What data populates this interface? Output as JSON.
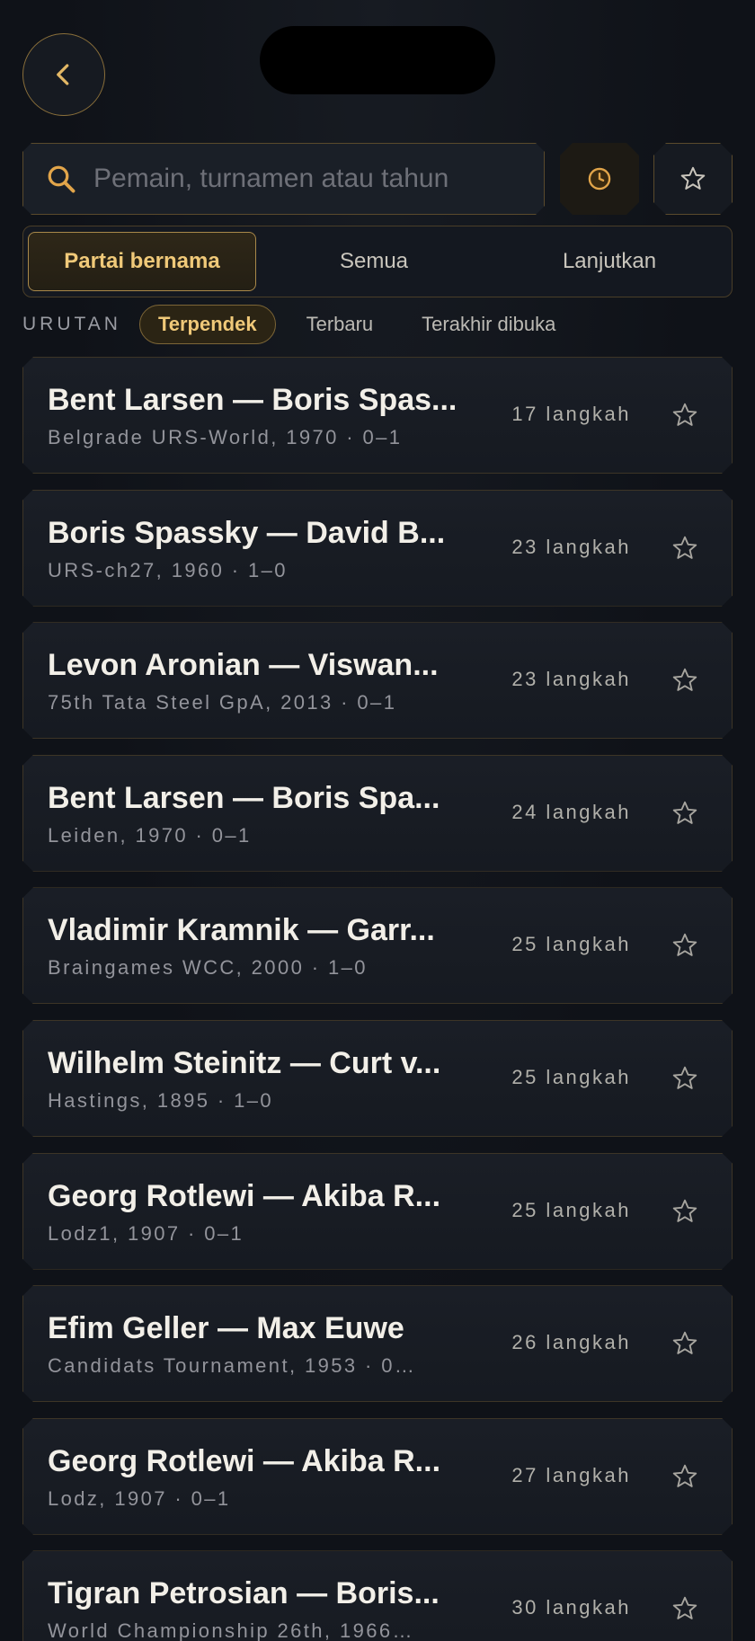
{
  "search": {
    "placeholder": "Pemain, turnamen atau tahun",
    "value": ""
  },
  "tabs": [
    {
      "label": "Partai bernama",
      "active": true
    },
    {
      "label": "Semua",
      "active": false
    },
    {
      "label": "Lanjutkan",
      "active": false
    }
  ],
  "sort": {
    "label": "URUTAN",
    "options": [
      {
        "label": "Terpendek",
        "active": true
      },
      {
        "label": "Terbaru",
        "active": false
      },
      {
        "label": "Terakhir dibuka",
        "active": false
      }
    ]
  },
  "games": [
    {
      "title": "Bent Larsen — Boris Spas...",
      "meta": "Belgrade URS-World, 1970 · 0–1",
      "moves": "17 langkah"
    },
    {
      "title": "Boris Spassky — David B...",
      "meta": "URS-ch27, 1960 · 1–0",
      "moves": "23 langkah"
    },
    {
      "title": "Levon Aronian — Viswan...",
      "meta": "75th Tata Steel GpA, 2013 · 0–1",
      "moves": "23 langkah"
    },
    {
      "title": "Bent Larsen — Boris Spa...",
      "meta": "Leiden, 1970 · 0–1",
      "moves": "24 langkah"
    },
    {
      "title": "Vladimir Kramnik — Garr...",
      "meta": "Braingames WCC, 2000 · 1–0",
      "moves": "25 langkah"
    },
    {
      "title": "Wilhelm Steinitz — Curt v...",
      "meta": "Hastings, 1895 · 1–0",
      "moves": "25 langkah"
    },
    {
      "title": "Georg Rotlewi — Akiba R...",
      "meta": "Lodz1, 1907 · 0–1",
      "moves": "25 langkah"
    },
    {
      "title": "Efim Geller — Max Euwe",
      "meta": "Candidats Tournament, 1953 · 0…",
      "moves": "26 langkah"
    },
    {
      "title": "Georg Rotlewi — Akiba R...",
      "meta": "Lodz, 1907 · 0–1",
      "moves": "27 langkah"
    },
    {
      "title": "Tigran Petrosian — Boris...",
      "meta": "World Championship 26th, 1966…",
      "moves": "30 langkah"
    }
  ],
  "icons": {
    "back": "chevron-left-icon",
    "search": "search-icon",
    "history": "clock-icon",
    "favorites": "star-icon"
  },
  "colors": {
    "accent": "#f0c979",
    "border": "#5a4a2c",
    "background": "#0f1218"
  }
}
